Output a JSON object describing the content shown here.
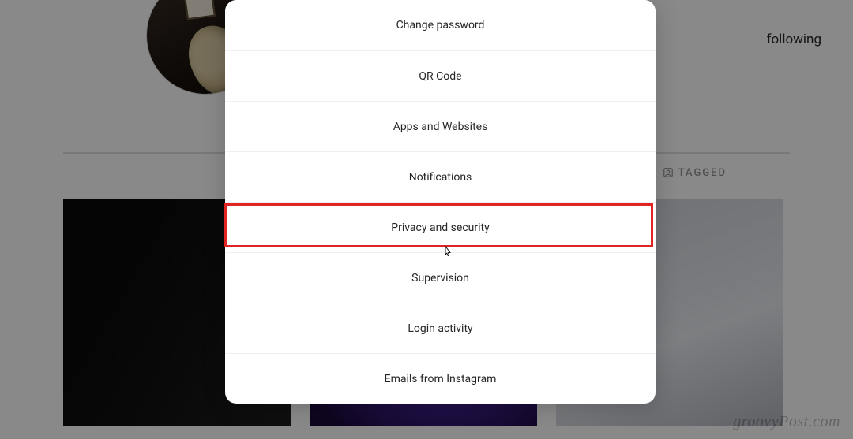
{
  "profile": {
    "stats_suffix": "following"
  },
  "tabs": {
    "tagged_label": "TAGGED"
  },
  "settings_menu": {
    "items": [
      {
        "label": "Change password",
        "key": "change-password"
      },
      {
        "label": "QR Code",
        "key": "qr-code"
      },
      {
        "label": "Apps and Websites",
        "key": "apps-and-websites"
      },
      {
        "label": "Notifications",
        "key": "notifications"
      },
      {
        "label": "Privacy and security",
        "key": "privacy-and-security",
        "highlighted": true
      },
      {
        "label": "Supervision",
        "key": "supervision"
      },
      {
        "label": "Login activity",
        "key": "login-activity"
      },
      {
        "label": "Emails from Instagram",
        "key": "emails-from-instagram"
      }
    ]
  },
  "watermark": "groovyPost.com"
}
